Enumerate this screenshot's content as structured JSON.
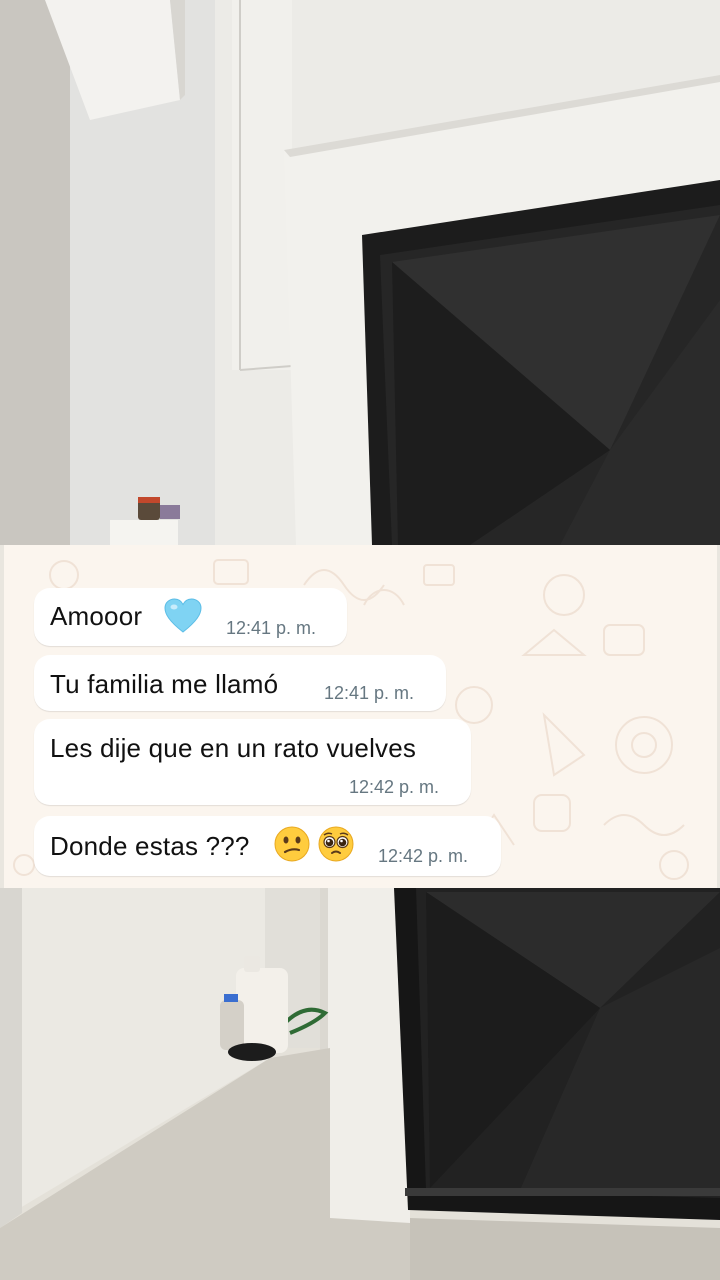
{
  "chat": {
    "messages": [
      {
        "text": "Amooor",
        "time": "12:41 p. m.",
        "emoji": [
          "light-blue-heart"
        ]
      },
      {
        "text": "Tu familia me llamó",
        "time": "12:41 p. m."
      },
      {
        "text": "Les dije que en un rato vuelves",
        "time": "12:42 p. m."
      },
      {
        "text": "Donde estas ???",
        "time": "12:42 p. m.",
        "emoji": [
          "confused-face",
          "pleading-face"
        ]
      }
    ]
  },
  "colors": {
    "bubble": "#ffffff",
    "chat_background": "#fbf5ee",
    "timestamp": "#667781",
    "door": "#1e1e1e",
    "wall": "#ecebe7"
  }
}
